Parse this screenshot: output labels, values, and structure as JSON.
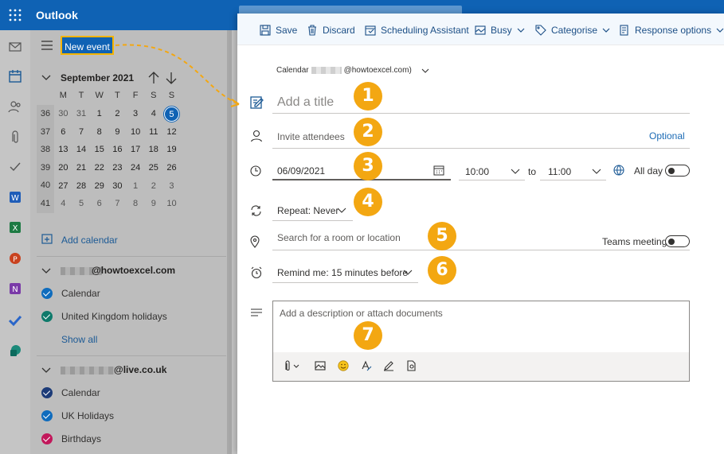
{
  "app": {
    "title": "Outlook"
  },
  "sidebar": {
    "new_event_label": "New event",
    "month_title": "September 2021",
    "weekdays": [
      "M",
      "T",
      "W",
      "T",
      "F",
      "S",
      "S"
    ],
    "weeks": [
      {
        "wk": "36",
        "days": [
          "30",
          "31",
          "1",
          "2",
          "3",
          "4",
          "5"
        ]
      },
      {
        "wk": "37",
        "days": [
          "6",
          "7",
          "8",
          "9",
          "10",
          "11",
          "12"
        ]
      },
      {
        "wk": "38",
        "days": [
          "13",
          "14",
          "15",
          "16",
          "17",
          "18",
          "19"
        ]
      },
      {
        "wk": "39",
        "days": [
          "20",
          "21",
          "22",
          "23",
          "24",
          "25",
          "26"
        ]
      },
      {
        "wk": "40",
        "days": [
          "27",
          "28",
          "29",
          "30",
          "1",
          "2",
          "3"
        ]
      },
      {
        "wk": "41",
        "days": [
          "4",
          "5",
          "6",
          "7",
          "8",
          "9",
          "10"
        ]
      }
    ],
    "today": "5",
    "add_calendar": "Add calendar",
    "account1": {
      "name": "@howtoexcel.com",
      "calendars": [
        {
          "label": "Calendar",
          "color": "#0f6cbd"
        },
        {
          "label": "United Kingdom holidays",
          "color": "#0e7a6b"
        }
      ],
      "show_all": "Show all"
    },
    "account2": {
      "name": "@live.co.uk",
      "calendars": [
        {
          "label": "Calendar",
          "color": "#1c3b78"
        },
        {
          "label": "UK Holidays",
          "color": "#0f6cbd"
        },
        {
          "label": "Birthdays",
          "color": "#c2185b"
        }
      ]
    }
  },
  "toolbar": {
    "save": "Save",
    "discard": "Discard",
    "scheduling": "Scheduling Assistant",
    "busy": "Busy",
    "categorise": "Categorise",
    "response": "Response options"
  },
  "event": {
    "calendar_prefix": "Calendar",
    "calendar_suffix": "@howtoexcel.com)",
    "title_placeholder": "Add a title",
    "attendees_placeholder": "Invite attendees",
    "optional": "Optional",
    "start_date": "06/09/2021",
    "start_time": "10:00",
    "to_label": "to",
    "end_time": "11:00",
    "all_day": "All day",
    "repeat": "Repeat: Never",
    "location_placeholder": "Search for a room or location",
    "teams_meeting": "Teams meeting",
    "remind": "Remind me: 15 minutes before",
    "description_placeholder": "Add a description or attach documents"
  },
  "badges": [
    "1",
    "2",
    "3",
    "4",
    "5",
    "6",
    "7"
  ],
  "colors": {
    "brand": "#0f62b4",
    "highlight": "#f3a712"
  }
}
